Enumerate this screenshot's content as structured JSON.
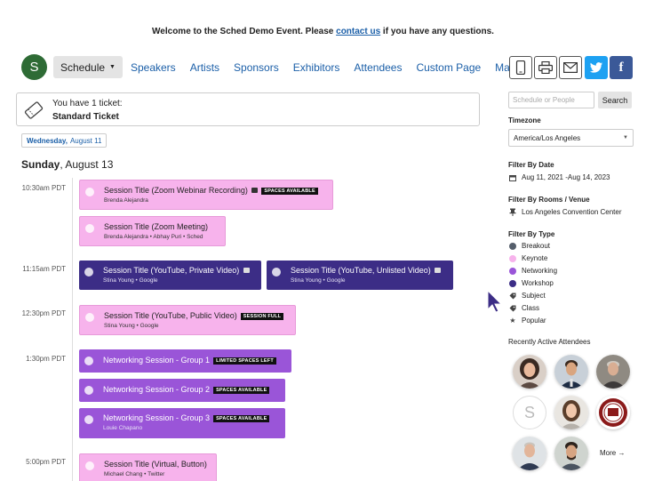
{
  "welcome": {
    "before": "Welcome to the Sched Demo Event. Please ",
    "link": "contact us",
    "after": " if you have any questions."
  },
  "logo_letter": "S",
  "nav": {
    "schedule_label": "Schedule",
    "links": [
      "Speakers",
      "Artists",
      "Sponsors",
      "Exhibitors",
      "Attendees",
      "Custom Page",
      "Map"
    ]
  },
  "toolbar_icons": [
    "mobile-icon",
    "print-icon",
    "mail-icon",
    "twitter-icon",
    "facebook-icon"
  ],
  "ticket": {
    "line1": "You have 1 ticket:",
    "line2": "Standard Ticket"
  },
  "date_chip": {
    "weekday": "Wednesday,",
    "date": "August 11"
  },
  "day_heading": {
    "weekday": "Sunday",
    "date": ", August 13"
  },
  "times": [
    "10:30am PDT",
    "11:15am PDT",
    "12:30pm PDT",
    "1:30pm PDT",
    "5:00pm PDT"
  ],
  "sessions": [
    {
      "title": "Session Title (Zoom Webinar Recording)",
      "badge": "SPACES AVAILABLE",
      "sub": "Brenda Alejandra",
      "type": "keynote"
    },
    {
      "title": "Session Title (Zoom Meeting)",
      "badge": "",
      "sub": "Brenda Alejandra • Abhay Puri • Sched",
      "type": "keynote"
    },
    {
      "title": "Session Title (YouTube, Private Video)",
      "badge": "",
      "sub": "Stina Young • Google",
      "type": "workshop"
    },
    {
      "title": "Session Title (YouTube, Unlisted Video)",
      "badge": "",
      "sub": "Stina Young • Google",
      "type": "workshop"
    },
    {
      "title": "Session Title (YouTube, Public Video)",
      "badge": "SESSION FULL",
      "sub": "Stina Young • Google",
      "type": "keynote"
    },
    {
      "title": "Networking Session - Group 1",
      "badge": "LIMITED SPACES LEFT",
      "sub": "",
      "type": "networking"
    },
    {
      "title": "Networking Session - Group 2",
      "badge": "SPACES AVAILABLE",
      "sub": "",
      "type": "networking"
    },
    {
      "title": "Networking Session - Group 3",
      "badge": "SPACES AVAILABLE",
      "sub": "Louie Chapano",
      "type": "networking"
    },
    {
      "title": "Session Title (Virtual, Button)",
      "badge": "",
      "sub": "Michael Chang • Twitter",
      "type": "keynote"
    }
  ],
  "sidebar": {
    "search_placeholder": "Schedule or People",
    "search_button": "Search",
    "timezone_heading": "Timezone",
    "timezone_value": "America/Los Angeles",
    "filter_date_heading": "Filter By Date",
    "filter_date_value": "Aug 11, 2021 -Aug 14, 2023",
    "filter_venue_heading": "Filter By Rooms / Venue",
    "filter_venue_value": "Los Angeles Convention Center",
    "filter_type_heading": "Filter By Type",
    "types": [
      {
        "label": "Breakout",
        "color": "#555e6b"
      },
      {
        "label": "Keynote",
        "color": "#f7b3ec"
      },
      {
        "label": "Networking",
        "color": "#9a55d8"
      },
      {
        "label": "Workshop",
        "color": "#3c2d86"
      }
    ],
    "tags": [
      {
        "label": "Subject",
        "icon": "tag-icon"
      },
      {
        "label": "Class",
        "icon": "tag-icon"
      },
      {
        "label": "Popular",
        "icon": "star-icon"
      }
    ],
    "attendees_heading": "Recently Active Attendees",
    "blank_avatar_letter": "S",
    "more_label": "More →"
  },
  "colors": {
    "keynote": "#f7b3ec",
    "workshop": "#3c2d86",
    "networking": "#9a55d8",
    "link": "#1b5fa8"
  }
}
